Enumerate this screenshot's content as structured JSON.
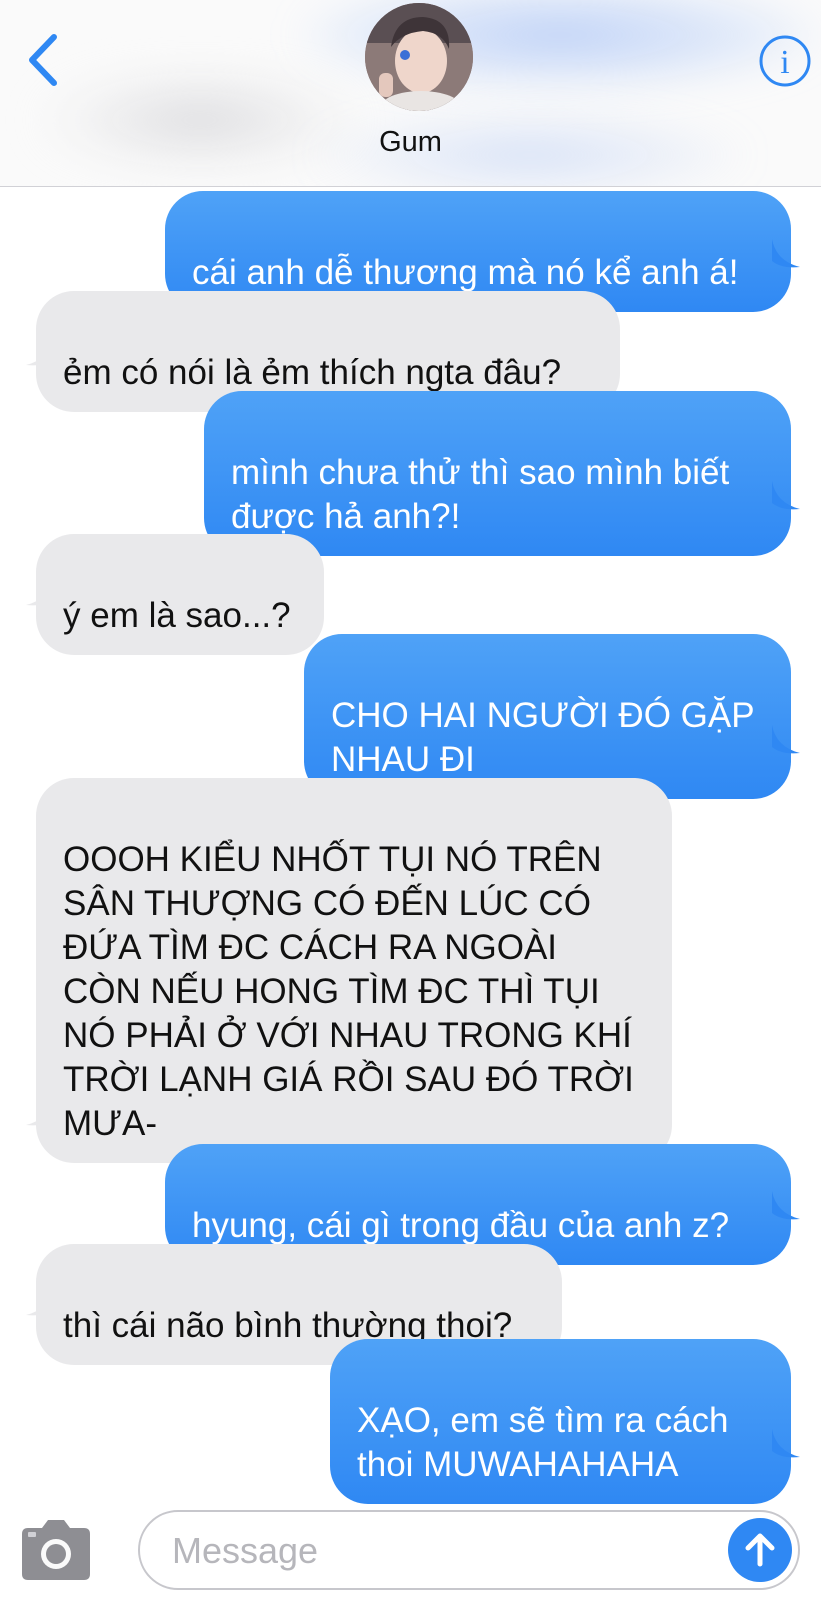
{
  "header": {
    "contact_name": "Gum",
    "back_icon": "chevron-left-icon",
    "info_icon": "info-icon",
    "accent_color": "#2f88f3"
  },
  "messages": [
    {
      "direction": "sent",
      "text": "cái anh dễ thương mà nó kể anh á!"
    },
    {
      "direction": "received",
      "text": "ẻm có nói là ẻm thích ngta đâu?"
    },
    {
      "direction": "sent",
      "text": "mình chưa thử thì sao mình biết\nđược hả anh?!"
    },
    {
      "direction": "received",
      "text": "ý em là sao...?"
    },
    {
      "direction": "sent",
      "text": "CHO HAI NGƯỜI ĐÓ GẶP\nNHAU ĐI"
    },
    {
      "direction": "received",
      "text": "OOOH KIỂU NHỐT TỤI NÓ TRÊN\nSÂN THƯỢNG CÓ ĐẾN LÚC CÓ\nĐỨA TÌM ĐC CÁCH RA NGOÀI\nCÒN NẾU HONG TÌM ĐC THÌ TỤI\nNÓ PHẢI Ở VỚI NHAU TRONG KHÍ\nTRỜI LẠNH GIÁ RỒI SAU ĐÓ TRỜI\nMƯA-"
    },
    {
      "direction": "sent",
      "text": "hyung, cái gì trong đầu của anh z?"
    },
    {
      "direction": "received",
      "text": "thì cái não bình thường thoi?"
    },
    {
      "direction": "sent",
      "text": "XẠO, em sẽ tìm ra cách\nthoi MUWAHAHAHA"
    }
  ],
  "composer": {
    "placeholder": "Message",
    "camera_icon": "camera-icon",
    "send_icon": "arrow-up-icon"
  }
}
